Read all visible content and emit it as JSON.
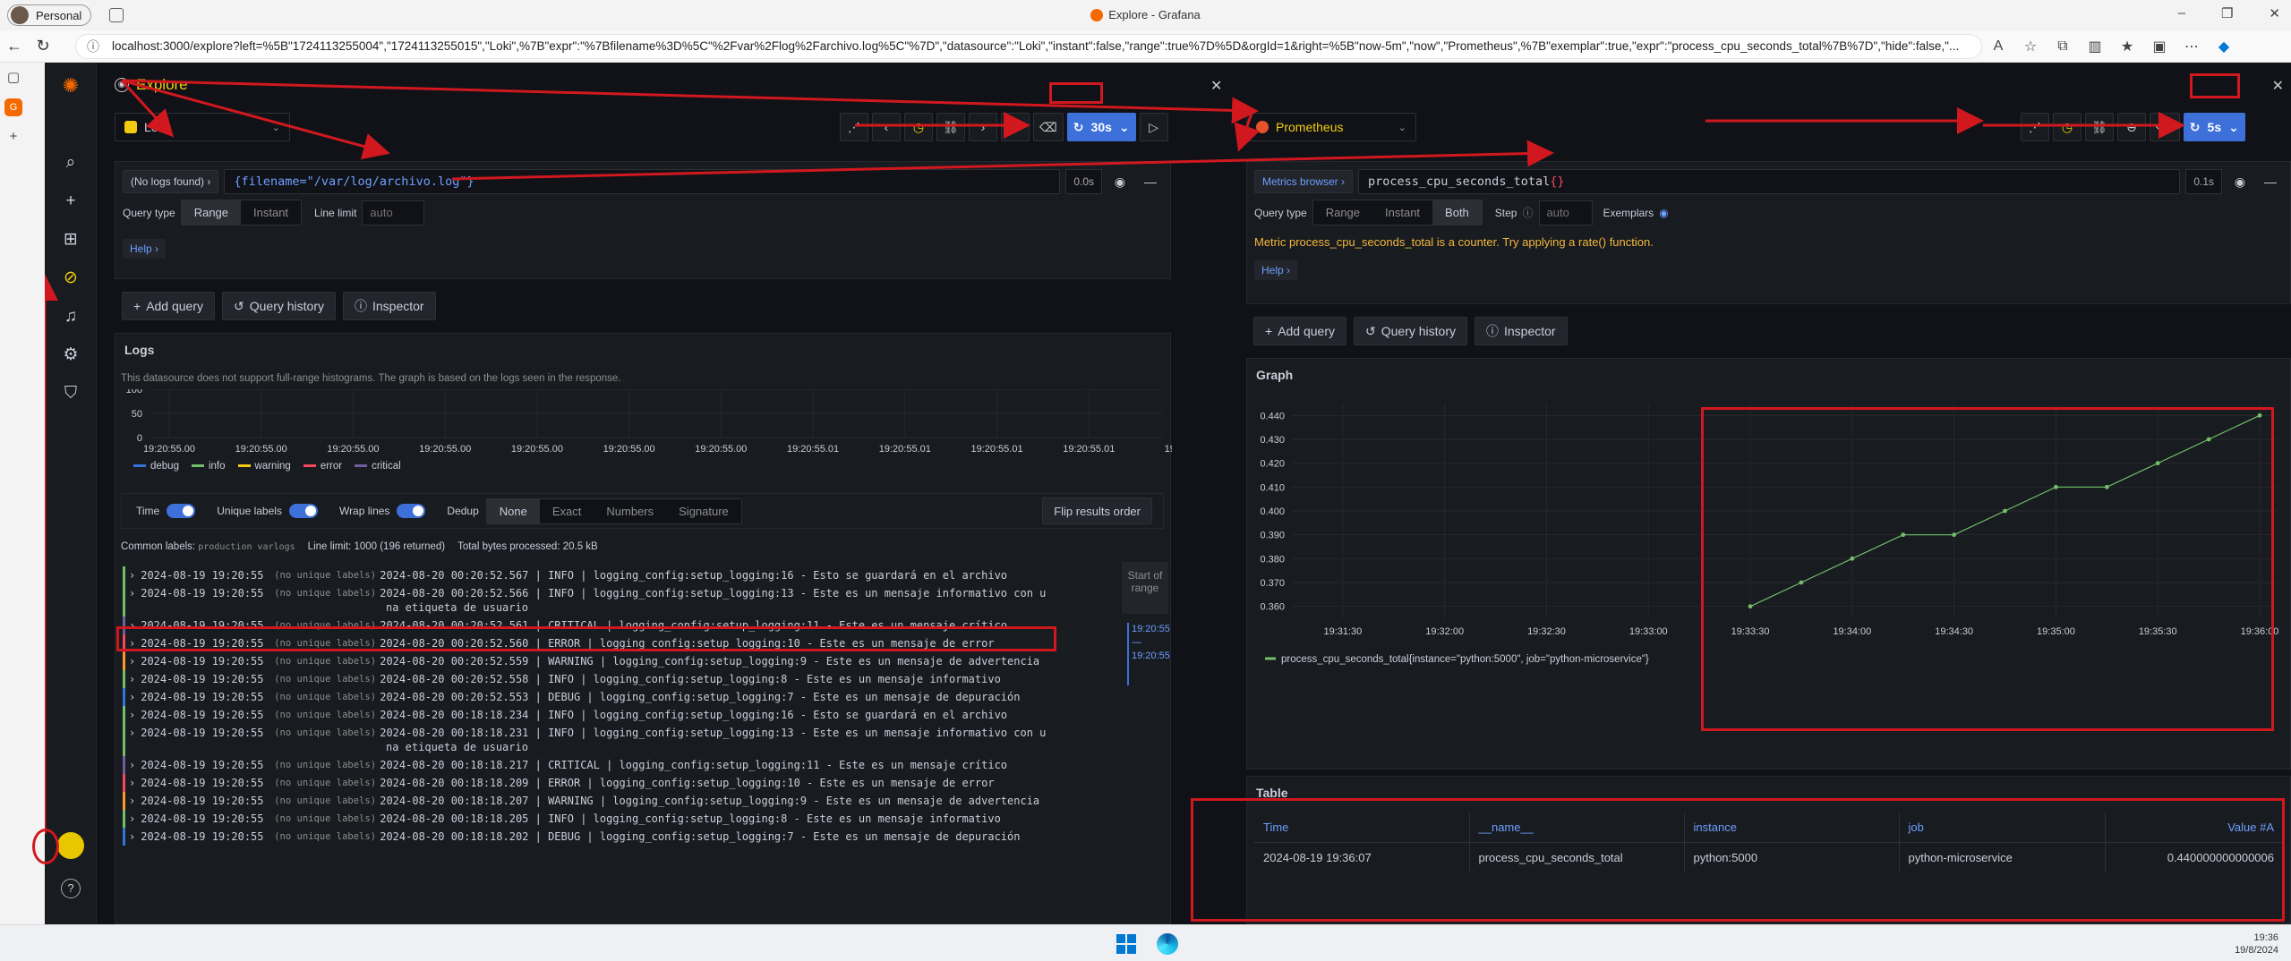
{
  "browser": {
    "profile": "Personal",
    "window_title": "Explore - Grafana",
    "url": "localhost:3000/explore?left=%5B\"1724113255004\",\"1724113255015\",\"Loki\",%7B\"expr\":\"%7Bfilename%3D%5C\"%2Fvar%2Flog%2Farchivo.log%5C\"%7D\",\"datasource\":\"Loki\",\"instant\":false,\"range\":true%7D%5D&orgId=1&right=%5B\"now-5m\",\"now\",\"Prometheus\",%7B\"exemplar\":true,\"expr\":\"process_cpu_seconds_total%7B%7D\",\"hide\":false,\"...",
    "min_icon": "–",
    "max_icon": "❐",
    "close_icon": "✕"
  },
  "left": {
    "title": "Explore",
    "datasource": "Loki",
    "refresh": "30s",
    "no_logs": "(No logs found) ›",
    "query": "{filename=\"/var/log/archivo.log\"}",
    "duration": "0.0s",
    "query_type_label": "Query type",
    "range": "Range",
    "instant": "Instant",
    "line_limit_label": "Line limit",
    "line_limit_placeholder": "auto",
    "help": "Help ›",
    "add_query": "Add query",
    "query_history": "Query history",
    "inspector": "Inspector",
    "logs": {
      "title": "Logs",
      "note": "This datasource does not support full-range histograms. The graph is based on the logs seen in the response.",
      "y_ticks": [
        "100",
        "50",
        "0"
      ],
      "x_ticks": [
        "19:20:55.00",
        "19:20:55.00",
        "19:20:55.00",
        "19:20:55.00",
        "19:20:55.00",
        "19:20:55.00",
        "19:20:55.00",
        "19:20:55.01",
        "19:20:55.01",
        "19:20:55.01",
        "19:20:55.01",
        "19:20:5"
      ],
      "legend": [
        {
          "name": "debug",
          "color": "#3274d9"
        },
        {
          "name": "info",
          "color": "#73bf69"
        },
        {
          "name": "warning",
          "color": "#f2cc0c"
        },
        {
          "name": "error",
          "color": "#f2495c"
        },
        {
          "name": "critical",
          "color": "#705da0"
        }
      ],
      "toggles": [
        "Time",
        "Unique labels",
        "Wrap lines",
        "Dedup"
      ],
      "dedup_options": [
        "None",
        "Exact",
        "Numbers",
        "Signature"
      ],
      "flip": "Flip results order",
      "common_labels": "Common labels:",
      "common_label_values": "production  varlogs",
      "line_limit": "Line limit: 1000 (196 returned)",
      "bytes": "Total bytes processed: 20.5 kB",
      "start_of_range": "Start of range",
      "range_top": "19:20:55",
      "range_mid": "—",
      "range_bottom": "19:20:55",
      "lines": [
        {
          "ts": "2024-08-19 19:20:55",
          "lbl": "(no unique labels)",
          "msg": "2024-08-20 00:20:52.567 | INFO     | logging_config:setup_logging:16 - Esto se guardará en el archivo",
          "lvl": "info",
          "expand": "›"
        },
        {
          "ts": "2024-08-19 19:20:55",
          "lbl": "(no unique labels)",
          "msg": "2024-08-20 00:20:52.566 | INFO     | logging_config:setup_logging:13 - Este es un mensaje informativo con u",
          "msg2": "na etiqueta de usuario",
          "lvl": "info",
          "expand": "›"
        },
        {
          "ts": "2024-08-19 19:20:55",
          "lbl": "(no unique labels)",
          "msg": "2024-08-20 00:20:52.561 | CRITICAL | logging_config:setup_logging:11 - Este es un mensaje crítico",
          "lvl": "critical",
          "expand": "›"
        },
        {
          "ts": "2024-08-19 19:20:55",
          "lbl": "(no unique labels)",
          "msg": "2024-08-20 00:20:52.560 | ERROR    | logging_config:setup_logging:10 - Este es un mensaje de error",
          "lvl": "error",
          "expand": "›"
        },
        {
          "ts": "2024-08-19 19:20:55",
          "lbl": "(no unique labels)",
          "msg": "2024-08-20 00:20:52.559 | WARNING  | logging_config:setup_logging:9 - Este es un mensaje de advertencia",
          "lvl": "warning",
          "expand": "›"
        },
        {
          "ts": "2024-08-19 19:20:55",
          "lbl": "(no unique labels)",
          "msg": "2024-08-20 00:20:52.558 | INFO     | logging_config:setup_logging:8 - Este es un mensaje informativo",
          "lvl": "info",
          "expand": "›"
        },
        {
          "ts": "2024-08-19 19:20:55",
          "lbl": "(no unique labels)",
          "msg": "2024-08-20 00:20:52.553 | DEBUG    | logging_config:setup_logging:7 - Este es un mensaje de depuración",
          "lvl": "debug",
          "expand": "›"
        },
        {
          "ts": "2024-08-19 19:20:55",
          "lbl": "(no unique labels)",
          "msg": "2024-08-20 00:18:18.234 | INFO     | logging_config:setup_logging:16 - Esto se guardará en el archivo",
          "lvl": "info",
          "expand": "›"
        },
        {
          "ts": "2024-08-19 19:20:55",
          "lbl": "(no unique labels)",
          "msg": "2024-08-20 00:18:18.231 | INFO     | logging_config:setup_logging:13 - Este es un mensaje informativo con u",
          "msg2": "na etiqueta de usuario",
          "lvl": "info",
          "expand": "›"
        },
        {
          "ts": "2024-08-19 19:20:55",
          "lbl": "(no unique labels)",
          "msg": "2024-08-20 00:18:18.217 | CRITICAL | logging_config:setup_logging:11 - Este es un mensaje crítico",
          "lvl": "critical",
          "expand": "›"
        },
        {
          "ts": "2024-08-19 19:20:55",
          "lbl": "(no unique labels)",
          "msg": "2024-08-20 00:18:18.209 | ERROR    | logging_config:setup_logging:10 - Este es un mensaje de error",
          "lvl": "error",
          "expand": "›"
        },
        {
          "ts": "2024-08-19 19:20:55",
          "lbl": "(no unique labels)",
          "msg": "2024-08-20 00:18:18.207 | WARNING  | logging_config:setup_logging:9 - Este es un mensaje de advertencia",
          "lvl": "warning",
          "expand": "›"
        },
        {
          "ts": "2024-08-19 19:20:55",
          "lbl": "(no unique labels)",
          "msg": "2024-08-20 00:18:18.205 | INFO     | logging_config:setup_logging:8 - Este es un mensaje informativo",
          "lvl": "info",
          "expand": "›"
        },
        {
          "ts": "2024-08-19 19:20:55",
          "lbl": "(no unique labels)",
          "msg": "2024-08-20 00:18:18.202 | DEBUG    | logging_config:setup_logging:7 - Este es un mensaje de depuración",
          "lvl": "debug",
          "expand": "›"
        }
      ]
    }
  },
  "right": {
    "datasource": "Prometheus",
    "refresh": "5s",
    "metrics_browser": "Metrics browser ›",
    "query_name": "process_cpu_seconds_total",
    "query_braces": "{}",
    "duration": "0.1s",
    "query_type_label": "Query type",
    "range": "Range",
    "instant": "Instant",
    "both": "Both",
    "step_label": "Step",
    "step_placeholder": "auto",
    "exemplars": "Exemplars",
    "warning": "Metric process_cpu_seconds_total is a counter. Try applying a rate() function.",
    "help": "Help ›",
    "add_query": "Add query",
    "query_history": "Query history",
    "inspector": "Inspector",
    "graph_title": "Graph",
    "table_title": "Table",
    "table": {
      "headers": [
        "Time",
        "__name__",
        "instance",
        "job",
        "Value #A"
      ],
      "row": [
        "2024-08-19 19:36:07",
        "process_cpu_seconds_total",
        "python:5000",
        "python-microservice",
        "0.440000000000006"
      ]
    }
  },
  "chart_data": {
    "type": "line",
    "x": [
      "19:33:30",
      "19:33:45",
      "19:34:00",
      "19:34:15",
      "19:34:30",
      "19:34:45",
      "19:35:00",
      "19:35:15",
      "19:35:30",
      "19:35:45",
      "19:36:00"
    ],
    "x_ticks": [
      "19:31:30",
      "19:32:00",
      "19:32:30",
      "19:33:00",
      "19:33:30",
      "19:34:00",
      "19:34:30",
      "19:35:00",
      "19:35:30",
      "19:36:00"
    ],
    "y_ticks": [
      "0.440",
      "0.430",
      "0.420",
      "0.410",
      "0.400",
      "0.390",
      "0.380",
      "0.370",
      "0.360"
    ],
    "series": [
      {
        "name": "process_cpu_seconds_total{instance=\"python:5000\", job=\"python-microservice\"}",
        "values": [
          0.36,
          0.37,
          0.38,
          0.39,
          0.39,
          0.4,
          0.41,
          0.41,
          0.42,
          0.43,
          0.44
        ],
        "color": "#73bf69"
      }
    ],
    "ylim": [
      0.355,
      0.445
    ],
    "xlim": [
      "19:31:15",
      "19:36:05"
    ],
    "grid": true,
    "legend": "bottom-left"
  },
  "taskbar": {
    "time": "19:36",
    "date": "19/8/2024"
  }
}
